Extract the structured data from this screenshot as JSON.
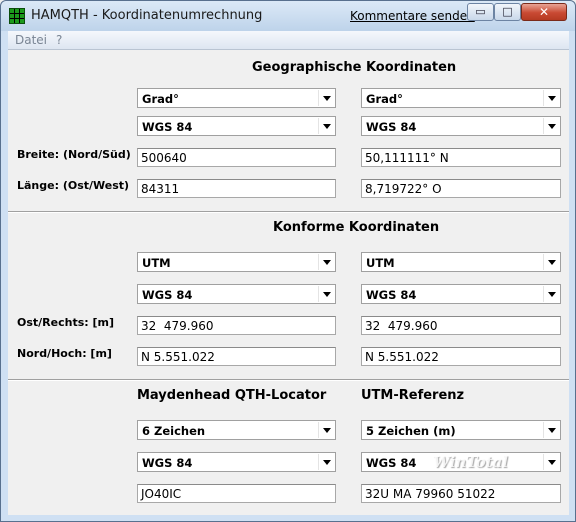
{
  "window": {
    "title": "HAMQTH - Koordinatenumrechnung",
    "feedback_link": "Kommentare senden"
  },
  "titlebar_buttons": {
    "minimize": "▭",
    "maximize": "□",
    "close": "✕"
  },
  "menu": [
    "Datei",
    "?"
  ],
  "geo": {
    "heading": "Geographische Koordinaten",
    "left_format": "Grad°",
    "right_format": "Grad°",
    "left_datum": "WGS 84",
    "right_datum": "WGS 84",
    "lat_label": "Breite: (Nord/Süd)",
    "lon_label": "Länge: (Ost/West)",
    "left_lat": "500640",
    "right_lat": "50,111111° N",
    "left_lon": "84311",
    "right_lon": "8,719722° O"
  },
  "conf": {
    "heading": "Konforme Koordinaten",
    "left_format": "UTM",
    "right_format": "UTM",
    "left_datum": "WGS 84",
    "right_datum": "WGS 84",
    "east_label": "Ost/Rechts: [m]",
    "north_label": "Nord/Hoch: [m]",
    "left_east": "32  479.960",
    "right_east": "32  479.960",
    "left_north": "N 5.551.022",
    "right_north": "N 5.551.022"
  },
  "loc": {
    "left_heading": "Maydenhead QTH-Locator",
    "right_heading": "UTM-Referenz",
    "left_format": "6 Zeichen",
    "right_format": "5 Zeichen (m)",
    "left_datum": "WGS 84",
    "right_datum": "WGS 84",
    "left_value": "JO40IC",
    "right_value": "32U MA 79960 51022"
  },
  "watermark": "WinTotal"
}
